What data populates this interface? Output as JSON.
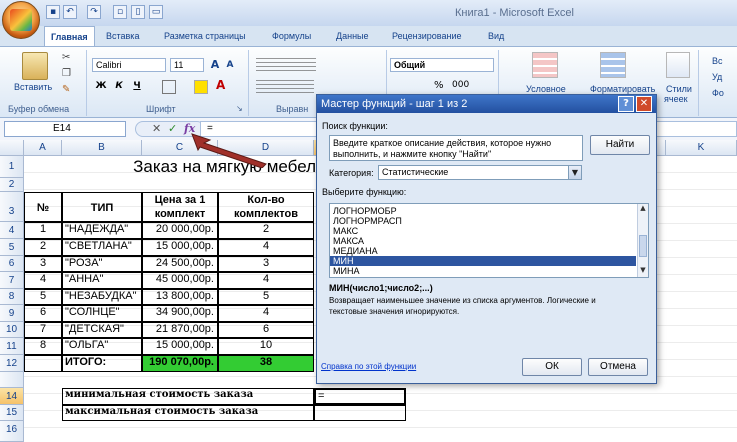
{
  "window": {
    "title": "Книга1 - Microsoft Excel"
  },
  "ribbon": {
    "tabs": [
      "Главная",
      "Вставка",
      "Разметка страницы",
      "Формулы",
      "Данные",
      "Рецензирование",
      "Вид"
    ],
    "clipboard": {
      "paste_label": "Вставить",
      "group_label": "Буфер обмена"
    },
    "font": {
      "name": "Calibri",
      "size": "11",
      "group_label": "Шрифт",
      "bold": "Ж",
      "italic": "К",
      "underline": "Ч"
    },
    "alignment": {
      "group_label": "Выравн"
    },
    "number": {
      "format": "Общий",
      "percent": "%",
      "thousands": "000"
    },
    "styles": {
      "conditional": "Условное",
      "format_table": "Форматировать",
      "cell_styles": "Стили",
      "cell_styles_2": "ячеек"
    },
    "cells": {
      "insert": "Вс",
      "delete": "Уд",
      "format": "Фо"
    }
  },
  "formula_bar": {
    "cell_ref": "E14",
    "cancel": "✕",
    "enter": "✓",
    "fx": "fx",
    "value": "="
  },
  "sheet": {
    "columns": [
      "A",
      "B",
      "C",
      "D",
      "",
      "",
      "",
      "",
      "K"
    ],
    "selected_col": "E",
    "rows": [
      "1",
      "2",
      "3",
      "4",
      "5",
      "6",
      "7",
      "8",
      "9",
      "10",
      "11",
      "12",
      "14",
      "15",
      "16"
    ],
    "title": "Заказ на мягкую мебель",
    "headers": {
      "no": "№",
      "type": "ТИП",
      "price": "Цена за 1",
      "price2": "комплект",
      "qty": "Кол-во",
      "qty2": "комплектов"
    },
    "data_rows": [
      {
        "no": "1",
        "type": "\"НАДЕЖДА\"",
        "price": "20 000,00р.",
        "qty": "2"
      },
      {
        "no": "2",
        "type": "\"СВЕТЛАНА\"",
        "price": "15 000,00р.",
        "qty": "4"
      },
      {
        "no": "3",
        "type": "\"РОЗА\"",
        "price": "24 500,00р.",
        "qty": "3"
      },
      {
        "no": "4",
        "type": "\"АННА\"",
        "price": "45 000,00р.",
        "qty": "4"
      },
      {
        "no": "5",
        "type": "\"НЕЗАБУДКА\"",
        "price": "13 800,00р.",
        "qty": "5"
      },
      {
        "no": "6",
        "type": "\"СОЛНЦЕ\"",
        "price": "34 900,00р.",
        "qty": "4"
      },
      {
        "no": "7",
        "type": "\"ДЕТСКАЯ\"",
        "price": "21 870,00р.",
        "qty": "6"
      },
      {
        "no": "8",
        "type": "\"ОЛЬГА\"",
        "price": "15 000,00р.",
        "qty": "10"
      }
    ],
    "total_label": "ИТОГО:",
    "total_price": "190 070,00р.",
    "total_qty": "38",
    "min_label": "минимальная стоимость заказа",
    "max_label": "максимальная стоимость заказа",
    "active_value": "="
  },
  "dialog": {
    "title": "Мастер функций - шаг 1 из 2",
    "help_icon": "?",
    "close_icon": "✕",
    "search_label": "Поиск функции:",
    "search_text_1": "Введите краткое описание действия, которое нужно",
    "search_text_2": "выполнить, и нажмите кнопку \"Найти\"",
    "find_button": "Найти",
    "category_label": "Категория:",
    "category_value": "Статистические",
    "select_label": "Выберите функцию:",
    "functions": [
      "ЛОГНОРМОБР",
      "ЛОГНОРМРАСП",
      "МАКС",
      "МАКСА",
      "МЕДИАНА",
      "МИН",
      "МИНА"
    ],
    "selected_function": "МИН",
    "signature": "МИН(число1;число2;...)",
    "description_1": "Возвращает наименьшее значение из списка аргументов. Логические и",
    "description_2": "текстовые значения игнорируются.",
    "help_link": "Справка по этой функции",
    "ok_button": "ОК",
    "cancel_button": "Отмена"
  },
  "colors": {
    "green_fill": "#33cc33",
    "dialog_title": "#2350a0",
    "arrow": "#a0302a"
  }
}
